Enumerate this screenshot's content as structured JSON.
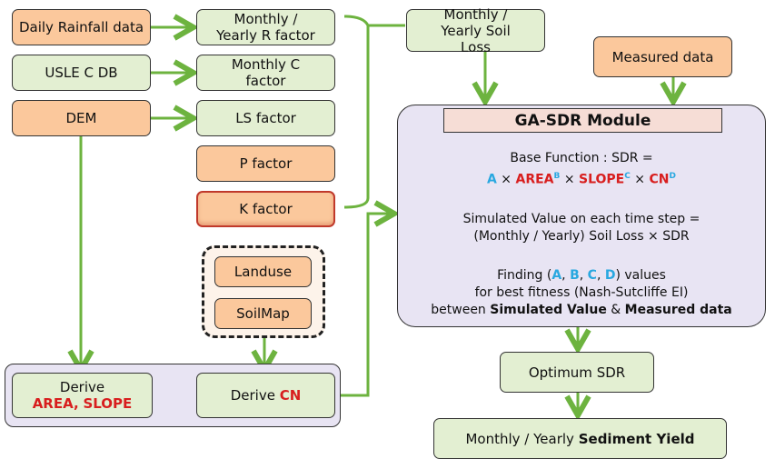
{
  "inputs": {
    "rainfall": "Daily Rainfall data",
    "usle": "USLE C DB",
    "dem": "DEM",
    "measured": "Measured data",
    "landuse": "Landuse",
    "soilmap": "SoilMap"
  },
  "factors": {
    "r": "Monthly / Yearly R factor",
    "c": "Monthly C factor",
    "ls": "LS factor",
    "p": "P factor",
    "k": "K factor"
  },
  "soil_loss": "Monthly / Yearly Soil Loss",
  "derive": {
    "prefix": "Derive",
    "area": "AREA",
    "comma": ",",
    "slope": "SLOPE",
    "cn": "CN"
  },
  "module": {
    "title": "GA-SDR Module",
    "base_line": "Base Function : SDR =",
    "a": "A",
    "area": "AREA",
    "b": "B",
    "slope": "SLOPE",
    "c": "C",
    "cn": "CN",
    "d": "D",
    "times": " × ",
    "sim1": "Simulated Value on each time step =",
    "sim2": "(Monthly / Yearly) Soil Loss × SDR",
    "find_pre": "Finding (",
    "find_post": ") values",
    "fit": "for best fitness (Nash-Sutcliffe EI)",
    "between": "between",
    "simval": "Simulated Value",
    "amp": "&",
    "meas": "Measured data"
  },
  "optimum": "Optimum SDR",
  "sediment": {
    "prefix": "Monthly / Yearly",
    "bold": "Sediment Yield"
  },
  "colors": {
    "input": "#fbc89c",
    "derived": "#e3efd2",
    "arrow": "#6db33f",
    "highlight_red": "#d81e1e",
    "highlight_blue": "#29a8e0",
    "module_bg": "#e8e4f3"
  }
}
